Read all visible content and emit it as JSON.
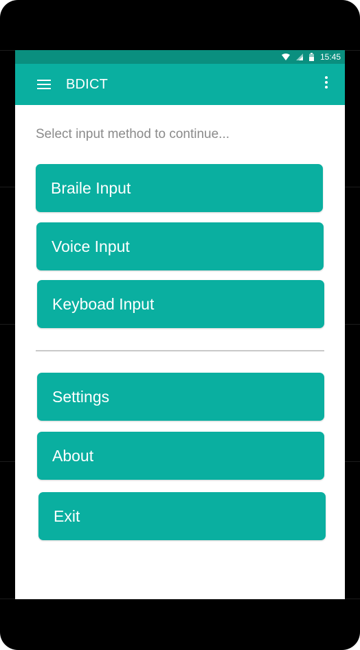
{
  "status_bar": {
    "time": "15:45",
    "icons": [
      "wifi-icon",
      "signal-icon",
      "battery-icon"
    ]
  },
  "toolbar": {
    "title": "BDICT",
    "menu_icon": "hamburger-menu-icon",
    "overflow_icon": "overflow-menu-icon"
  },
  "main": {
    "prompt": "Select input method to continue...",
    "input_buttons": [
      {
        "label": "Braile Input"
      },
      {
        "label": "Voice Input"
      },
      {
        "label": "Keyboad Input"
      }
    ],
    "other_buttons": [
      {
        "label": "Settings"
      },
      {
        "label": "About"
      },
      {
        "label": "Exit"
      }
    ]
  },
  "colors": {
    "accent": "#0aafa0",
    "status_bar": "#0a8f7f",
    "prompt_text": "#8a8a8a",
    "divider": "#c8c8c8"
  }
}
